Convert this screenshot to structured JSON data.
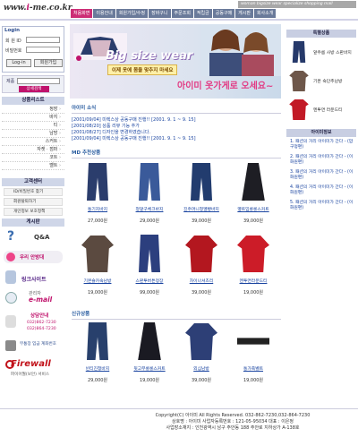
{
  "header": {
    "logo_prefix": "www.",
    "logo_mid": "i",
    "logo_suffix": "-me.co.kr",
    "tagline": "woman bigsize wear specialize shopping mall",
    "nav": [
      "처음화면",
      "이용안내",
      "회원가입/수정",
      "장바구니",
      "주문조회",
      "적립금",
      "공동구매",
      "게시판",
      "회사소개"
    ]
  },
  "login": {
    "title": "Login",
    "id_label": "회 원 ID",
    "pw_label": "비밀번호",
    "login_button": "Log-in",
    "join_button": "회원가입"
  },
  "search": {
    "label": "제품",
    "button": "상세검색"
  },
  "categories": {
    "title": "상품리스트",
    "items": [
      "정장",
      "바지",
      "티",
      "남방",
      "스커트",
      "자켓 · 점퍼",
      "코트",
      "벨트"
    ]
  },
  "customer_center": {
    "title": "고객센터",
    "items": [
      "ID/비밀번호 찾기",
      "회원탈퇴하기",
      "개인정보 보호정책"
    ]
  },
  "board": {
    "title": "게시판",
    "qa_label": "Q&A"
  },
  "left_banners": {
    "nanum": "우리 안방대",
    "link_site": "링크사이트",
    "email_label": "관리자",
    "email": "e-mail",
    "consult_title": "상담안내",
    "phone1": "032)862-7230",
    "phone2": "032)864-7230",
    "account_title": "무통장 입금 계좌번호",
    "firewall": "Firewall",
    "firewall_sub": "파이어월(보안) 서비스"
  },
  "banner": {
    "title": "Big size wear",
    "subtitle1": "이제 옷에 몸을 맞추지 마세요",
    "welcome": "아이미 옷가게로 오세요~"
  },
  "news": {
    "title": "아이미 소식",
    "items": [
      "[2001/09/04] 미렉스상 공동구매 진행!! [2001. 9. 1 ~ 9. 15]",
      "[2001/08/20] 상품 리뷰 기능 추가",
      "[2001/08/27] 디자인을 변경하였습니다.",
      "[2001/09/04] 미렉스상 공동구매 진행!! [2001. 9. 1 ~ 9. 15]"
    ]
  },
  "md_products": {
    "title": "MD 추천상품",
    "items": [
      {
        "name": "통기지바지",
        "price": "27,000원",
        "color": "#2b3d6c"
      },
      {
        "name": "청앞구체크바지",
        "price": "29,000원",
        "color": "#3a5a9a"
      },
      {
        "name": "진주머니청멜빵바지",
        "price": "39,000원",
        "color": "#223c6e"
      },
      {
        "name": "옆트임롱롱스커트",
        "price": "39,000원",
        "color": "#1e1e24"
      },
      {
        "name": "기본숄카숙남방",
        "price": "19,000원",
        "color": "#5b4a40"
      },
      {
        "name": "스판투버튼정장",
        "price": "99,000원",
        "color": "#2c3f7e"
      },
      {
        "name": "차이나셔츠리",
        "price": "39,000원",
        "color": "#b3171f"
      },
      {
        "name": "멘투면라운드티",
        "price": "19,000원",
        "color": "#cc1c28"
      }
    ]
  },
  "new_products": {
    "title": "신규상품",
    "items": [
      {
        "name": "빈티진청바지",
        "price": "29,000원",
        "color": "#28406c"
      },
      {
        "name": "뒷고무롱롱스커트",
        "price": "19,000원",
        "color": "#1a1a22"
      },
      {
        "name": "외심남방",
        "price": "39,000원",
        "color": "#2d3f76"
      },
      {
        "name": "통가죽벨트",
        "price": "19,000원",
        "color": "#222"
      }
    ]
  },
  "special": {
    "title": "특별상품",
    "items": [
      {
        "name": "앞주름 사방 스판바지",
        "color": "#26396a"
      },
      {
        "name": "기본 숙단추남방",
        "color": "#6e574a"
      },
      {
        "name": "멘투면 라운드티",
        "color": "#c21a26"
      }
    ]
  },
  "tips": {
    "title": "아이미정보",
    "items": [
      "1. 패션의 거리 아이미가 간다 - (압구정편)",
      "2. 패션의 거리 아이미가 간다 - (이화원편)",
      "3. 패션의 거리 아이미가 간다 - (이화원편)",
      "4. 패션의 거리 아이미가 간다 - (이화원편)",
      "5. 패션의 거리 아이미가 간다 - (이화원편)"
    ]
  },
  "footer": {
    "line1": "Copyright(C) 아이미 All Rights Reserved. 032-862-7230,032-864-7230",
    "line2": "상호명 : 아이미   사업자등록번호 : 121-05-95034   대표 : 이은정",
    "line3": "사업장소재지 : 인천광역시 남구 주안동 188 주안로 지하상가 A-138호"
  },
  "colors": {
    "accent": "#cc2d76",
    "nav": "#6a7a9a",
    "link": "#1a44a0"
  }
}
